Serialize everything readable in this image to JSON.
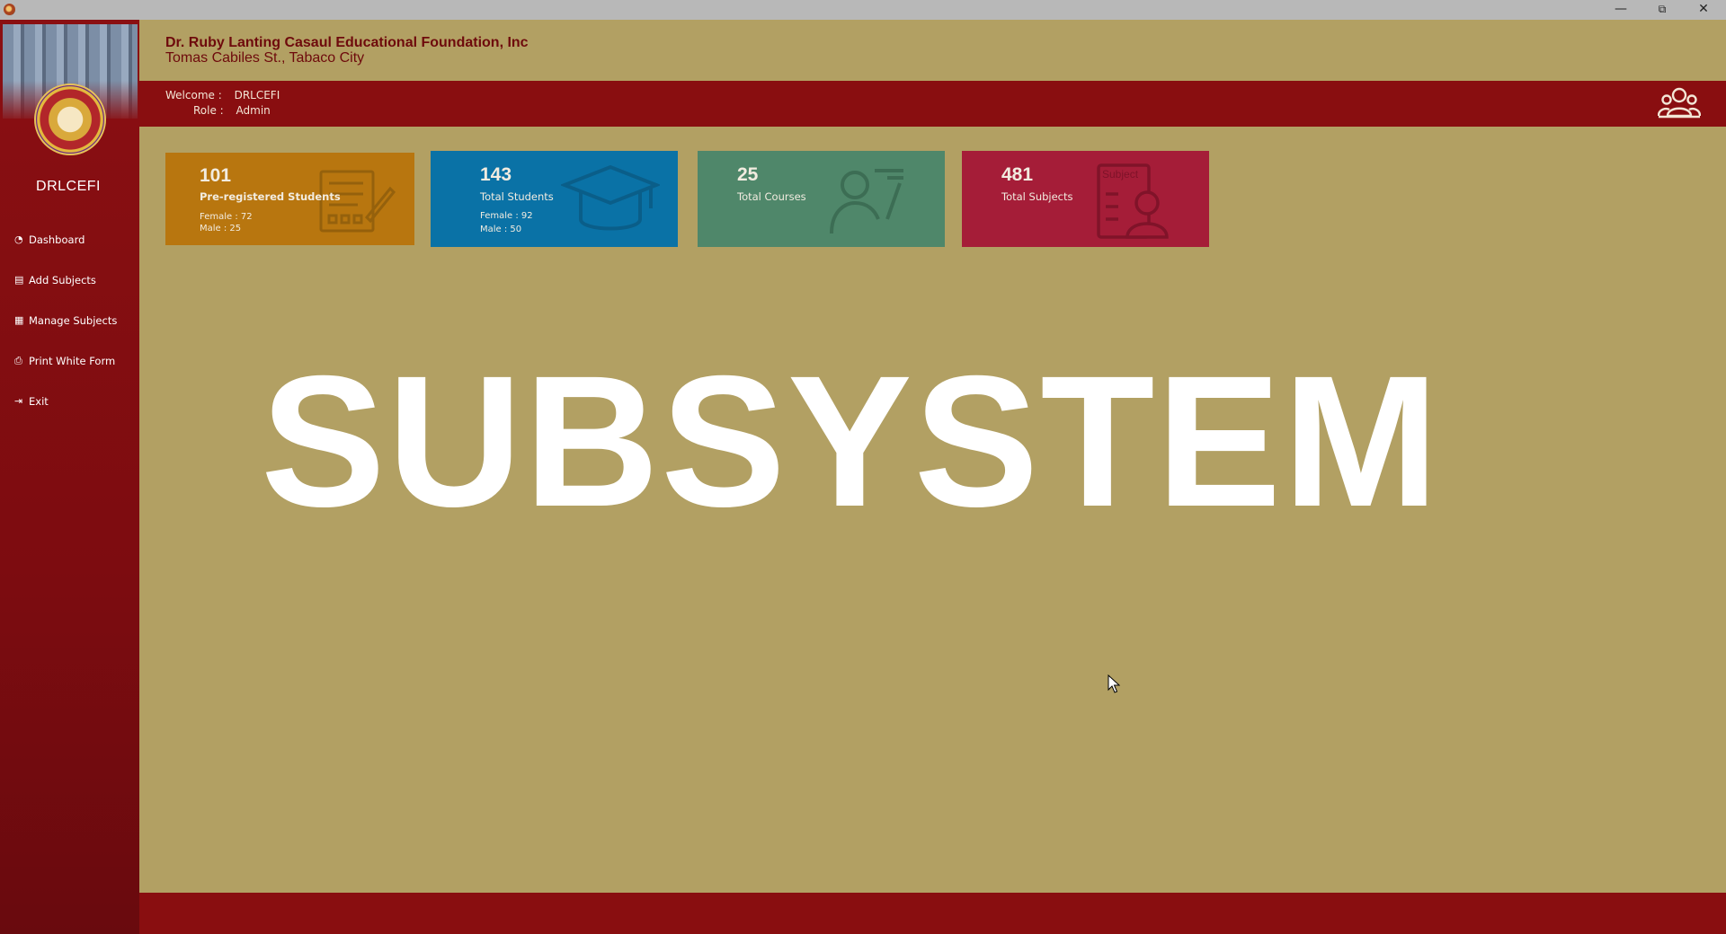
{
  "window": {
    "minimize": "—",
    "maximize": "⧉",
    "close": "✕"
  },
  "sidebar": {
    "brand": "DRLCEFI",
    "items": [
      {
        "label": "Dashboard",
        "icon": "gauge-icon",
        "glyph": "◔"
      },
      {
        "label": "Add Subjects",
        "icon": "document-icon",
        "glyph": "▤"
      },
      {
        "label": "Manage Subjects",
        "icon": "manage-icon",
        "glyph": "▦"
      },
      {
        "label": "Print White Form",
        "icon": "printer-icon",
        "glyph": "⎙"
      },
      {
        "label": "Exit",
        "icon": "exit-icon",
        "glyph": "⇥"
      }
    ]
  },
  "header": {
    "org_name": "Dr. Ruby Lanting Casaul Educational Foundation, Inc",
    "org_address": "Tomas Cabiles St., Tabaco City",
    "welcome_label": "Welcome :",
    "welcome_value": "DRLCEFI",
    "role_label": "Role :",
    "role_value": "Admin"
  },
  "cards": [
    {
      "number": "101",
      "label": "Pre-registered Students",
      "female": "Female : 72",
      "male": "Male : 25",
      "color": "#b8760f",
      "icon": "form-icon"
    },
    {
      "number": "143",
      "label": "Total Students",
      "female": "Female : 92",
      "male": "Male : 50",
      "color": "#0a72a6",
      "icon": "graduation-cap-icon"
    },
    {
      "number": "25",
      "label": "Total Courses",
      "color": "#4f876a",
      "icon": "teacher-icon"
    },
    {
      "number": "481",
      "label": "Total Subjects",
      "color": "#a51d38",
      "icon": "subject-card-icon",
      "icon_text": "Subject"
    }
  ],
  "main": {
    "title": "SUBSYSTEM"
  },
  "colors": {
    "background": "#b2a063",
    "accent": "#890e10",
    "sidebar": "#7d0c10"
  }
}
